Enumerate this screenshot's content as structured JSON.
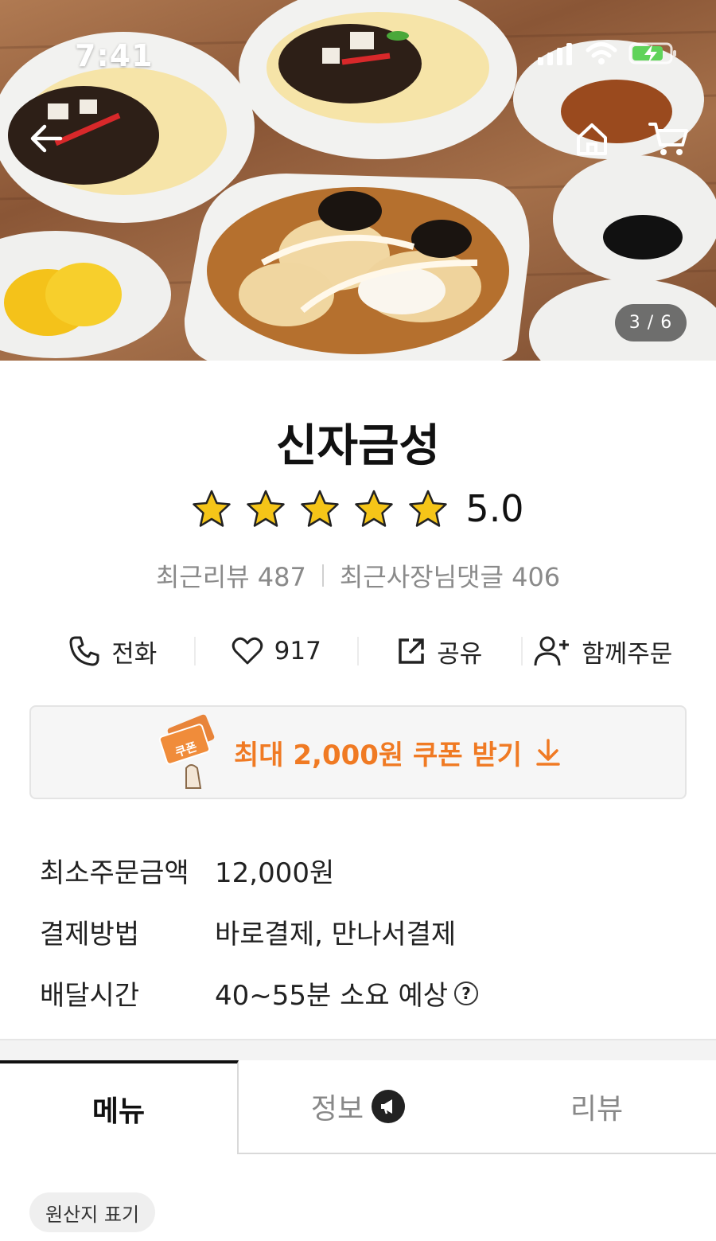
{
  "status_bar": {
    "time": "7:41"
  },
  "hero": {
    "icons": {
      "back": "arrow-left-icon",
      "home": "home-icon",
      "cart": "cart-icon"
    },
    "page_indicator": "3 / 6"
  },
  "store": {
    "name": "신자금성",
    "rating": "5.0",
    "stars_filled": 5,
    "recent_reviews": "최근리뷰 487",
    "recent_owner_replies": "최근사장님댓글 406"
  },
  "actions": {
    "call": "전화",
    "likes": "917",
    "share": "공유",
    "group_order": "함께주문"
  },
  "coupon": {
    "label": "최대 2,000원 쿠폰 받기",
    "ticket_text": "쿠폰"
  },
  "info": [
    {
      "label": "최소주문금액",
      "value": "12,000원"
    },
    {
      "label": "결제방법",
      "value": "바로결제, 만나서결제"
    },
    {
      "label": "배달시간",
      "value": "40~55분 소요 예상",
      "help": "?"
    }
  ],
  "tabs": {
    "menu": "메뉴",
    "info": "정보",
    "review": "리뷰"
  },
  "origin_chip": "원산지 표기",
  "colors": {
    "accent_orange": "#f07a23",
    "star": "#f5c518"
  }
}
